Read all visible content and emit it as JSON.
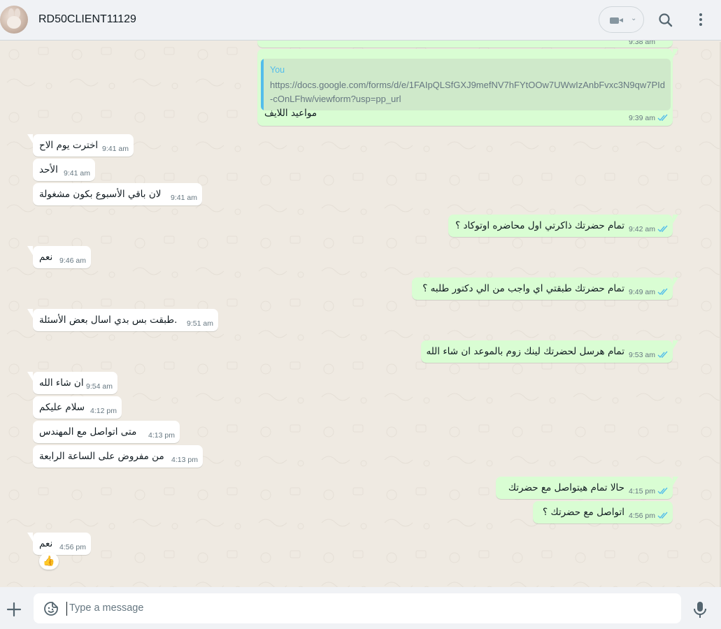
{
  "header": {
    "contact_name": "RD50CLIENT11129",
    "icons": [
      "contact-avatar",
      "video-call-icon",
      "chevron-down-icon",
      "search-icon",
      "menu-icon"
    ]
  },
  "messages": {
    "partial_time": "9:38 am",
    "m0": {
      "direction": "outgoing",
      "quote_author": "You",
      "quote_text": "https://docs.google.com/forms/d/e/1FAIpQLSfGXJ9mefNV7hFYtOOw7UWwIzAnbFvxc3N9qw7PId-cOnLFhw/viewform?usp=pp_url",
      "text": "مواعيد اللايف",
      "time": "9:39 am"
    },
    "m1": {
      "direction": "incoming",
      "text": "اخترت يوم الاح",
      "time": "9:41 am"
    },
    "m2": {
      "direction": "incoming",
      "text": "الأحد",
      "time": "9:41 am"
    },
    "m3": {
      "direction": "incoming",
      "text": "لان باقي الأسبوع بكون مشغولة",
      "time": "9:41 am"
    },
    "m4": {
      "direction": "outgoing",
      "text": "تمام حضرتك ذاكرتي اول محاضره اوتوكاد ؟",
      "time": "9:42 am"
    },
    "m5": {
      "direction": "incoming",
      "text": "نعم",
      "time": "9:46 am"
    },
    "m6": {
      "direction": "outgoing",
      "text": "تمام حضرتك طبقتي اي واجب من الي دكتور طلبه ؟",
      "time": "9:49 am"
    },
    "m7": {
      "direction": "incoming",
      "text": "طبقت بس بدي اسال بعض الأسئلة.",
      "time": "9:51 am"
    },
    "m8": {
      "direction": "outgoing",
      "text": "تمام هرسل لحضرتك لينك زوم بالموعد ان شاء الله",
      "time": "9:53 am"
    },
    "m9": {
      "direction": "incoming",
      "text": "ان شاء الله",
      "time": "9:54 am"
    },
    "m10": {
      "direction": "incoming",
      "text": "سلام عليكم",
      "time": "4:12 pm"
    },
    "m11": {
      "direction": "incoming",
      "text": "متى اتواصل مع المهندس",
      "time": "4:13 pm"
    },
    "m12": {
      "direction": "incoming",
      "text": "من مفروض على الساعة الرابعة",
      "time": "4:13 pm"
    },
    "m13": {
      "direction": "outgoing",
      "text": "حالا تمام هيتواصل مع حضرتك",
      "time": "4:15 pm"
    },
    "m14": {
      "direction": "outgoing",
      "text": "اتواصل مع حضرتك ؟",
      "time": "4:56 pm"
    },
    "m15": {
      "direction": "incoming",
      "text": "نعم",
      "time": "4:56 pm",
      "reaction": "👍"
    }
  },
  "composer": {
    "placeholder": "Type a message",
    "icons": [
      "attach-plus-icon",
      "sticker-icon",
      "microphone-icon"
    ]
  },
  "colors": {
    "chat_background": "#efeae2",
    "incoming_bubble": "#ffffff",
    "outgoing_bubble": "#d9fdd3",
    "read_ticks": "#53bdeb",
    "header_background": "#f0f2f5"
  }
}
